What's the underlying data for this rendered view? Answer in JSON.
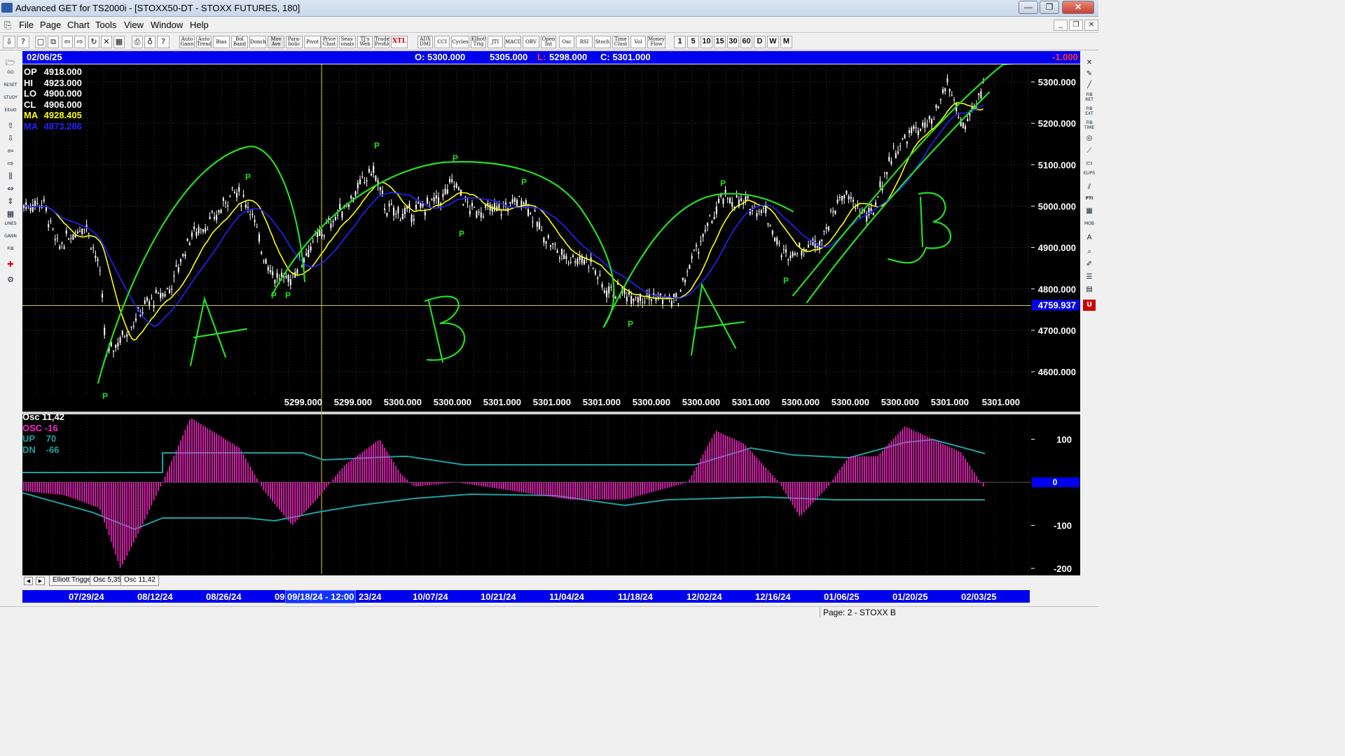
{
  "window": {
    "title": "Advanced GET for TS2000i - [STOXX50-DT - STOXX FUTURES, 180]",
    "minimize": "—",
    "maximize": "❐",
    "close": "✕"
  },
  "menu": [
    "File",
    "Page",
    "Chart",
    "Tools",
    "View",
    "Window",
    "Help"
  ],
  "toolbar": {
    "buttons": [
      "Auto Gann",
      "Auto Trend",
      "Bias",
      "Bol Band",
      "Donch",
      "Mov Ave",
      "Para-bolic",
      "Pivot",
      "Price Clust",
      "Seas-onals",
      "TJ's Web",
      "Trade Profile",
      "XTL",
      "ADX DMI",
      "CCI",
      "Cycles",
      "Elliott Trig",
      "JTI",
      "MACD",
      "OBV",
      "Open Int",
      "Osc",
      "RSI",
      "Stoch",
      "Time Clust",
      "Vol",
      "Money Flow"
    ],
    "periods": [
      "1",
      "5",
      "10",
      "15",
      "30",
      "60",
      "D",
      "W",
      "M"
    ]
  },
  "quote": {
    "date": "02/06/25",
    "open": "O: 5300.000",
    "high": "5305.000",
    "low_label": "L:",
    "low": "5298.000",
    "close": "C: 5301.000",
    "change": "-1.000"
  },
  "price_panel": {
    "legend": [
      {
        "label": "OP",
        "value": "4918.000",
        "color": "#ffffff"
      },
      {
        "label": "HI",
        "value": "4923.000",
        "color": "#ffffff"
      },
      {
        "label": "LO",
        "value": "4900.000",
        "color": "#ffffff"
      },
      {
        "label": "CL",
        "value": "4906.000",
        "color": "#ffffff"
      },
      {
        "label": "MA",
        "value": "4928.405",
        "color": "#ffff00"
      },
      {
        "label": "MA",
        "value": "4873.286",
        "color": "#2222ff"
      }
    ],
    "y_ticks": [
      "5300.000",
      "5200.000",
      "5100.000",
      "5000.000",
      "4900.000",
      "4800.000",
      "4700.000",
      "4600.000"
    ],
    "cursor_price": "4759.937",
    "bottom_prices": [
      "5299.000",
      "5299.000",
      "5300.000",
      "5300.000",
      "5301.000",
      "5301.000",
      "5301.000",
      "5300.000",
      "5300.000",
      "5301.000",
      "5300.000",
      "5300.000",
      "5300.000",
      "5301.000"
    ],
    "last_price": "5301.000",
    "pivot_marker": "P",
    "annotations": [
      "A",
      "B",
      "A",
      "B"
    ]
  },
  "osc_panel": {
    "title": "Osc 11,42",
    "legend": [
      {
        "label": "OSC",
        "value": "-16",
        "color": "#ff22cc"
      },
      {
        "label": "UP",
        "value": "70",
        "color": "#20a0a0"
      },
      {
        "label": "DN",
        "value": "-66",
        "color": "#20a0a0"
      }
    ],
    "y_ticks": [
      "100",
      "0",
      "-100",
      "-200"
    ],
    "zero_badge": "0"
  },
  "tabs": [
    "Elliott Trigger",
    "Osc 5,35",
    "Osc 11,42"
  ],
  "date_axis": {
    "labels": [
      "07/29/24",
      "08/12/24",
      "08/26/24",
      "09",
      "23/24",
      "10/07/24",
      "10/21/24",
      "11/04/24",
      "11/18/24",
      "12/02/24",
      "12/16/24",
      "01/06/25",
      "01/20/25",
      "02/03/25"
    ],
    "cursor": "09/18/24 - 12:00"
  },
  "status": {
    "page": "Page: 2 - STOXX B"
  },
  "colors": {
    "chart_bg": "#000000",
    "axis_bar": "#0000ee",
    "ma_fast": "#ffff00",
    "ma_slow": "#2222ff",
    "candles": "#ffffff",
    "histogram": "#ff22cc",
    "bands": "#20a0a0",
    "drawing": "#22dd22"
  }
}
